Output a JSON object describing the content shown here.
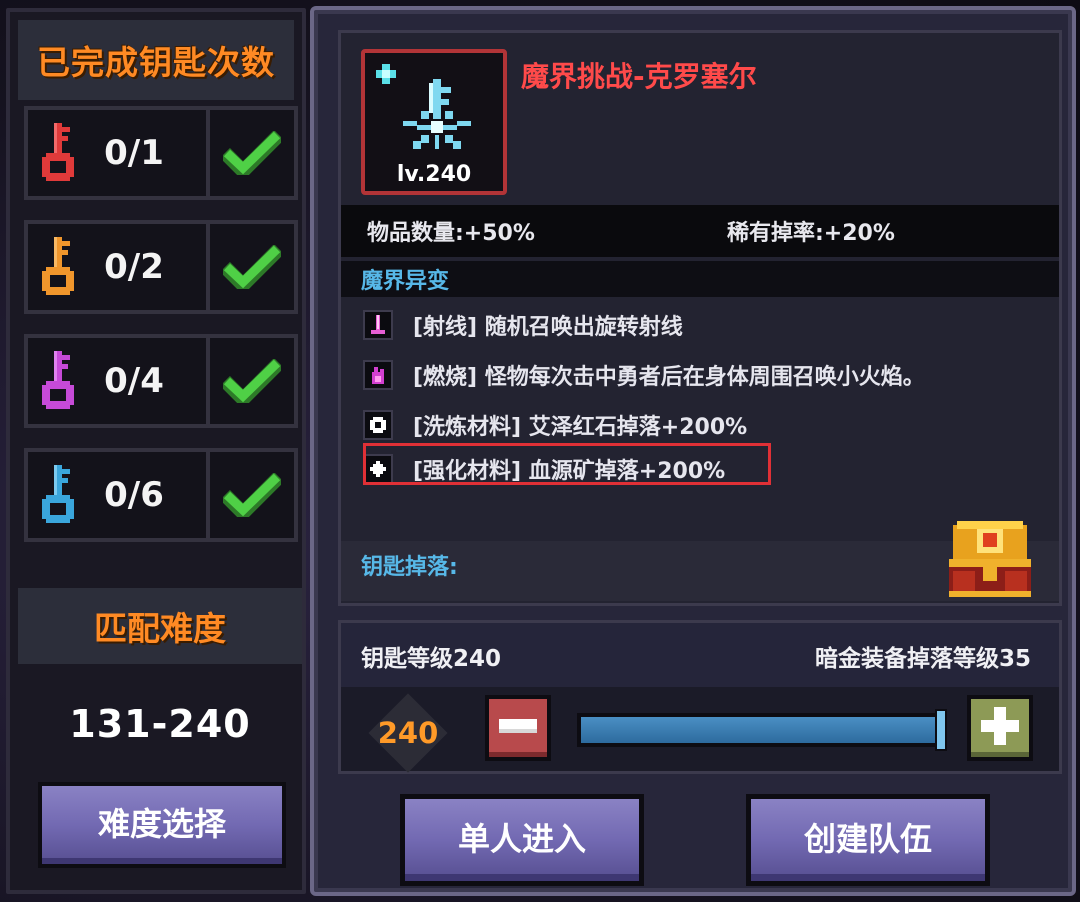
{
  "left_panel": {
    "title": "已完成钥匙次数",
    "key_rows": [
      {
        "count": "0/1",
        "color": "#e03a3a",
        "key_icon": "red-key-icon",
        "completed": true
      },
      {
        "count": "0/2",
        "color": "#f0962c",
        "key_icon": "orange-key-icon",
        "completed": true
      },
      {
        "count": "0/4",
        "color": "#c64ad8",
        "key_icon": "purple-key-icon",
        "completed": true
      },
      {
        "count": "0/6",
        "color": "#3aa6dc",
        "key_icon": "blue-key-icon",
        "completed": true
      }
    ],
    "match_title": "匹配难度",
    "match_range": "131-240",
    "difficulty_button": "难度选择"
  },
  "challenge": {
    "name": "魔界挑战-克罗塞尔",
    "item_level": "lv.240",
    "item_icon": "ice-crystal-key-icon",
    "stats": {
      "item_quantity": "物品数量:+50%",
      "rare_drop": "稀有掉率:+20%"
    },
    "mutation_label": "魔界异变",
    "modifiers": [
      {
        "text": "[射线] 随机召唤出旋转射线",
        "icon": "beam-icon"
      },
      {
        "text": "[燃烧] 怪物每次击中勇者后在身体周围召唤小火焰。",
        "icon": "flame-icon"
      },
      {
        "text": "[洗炼材料] 艾泽红石掉落+200%",
        "icon": "gear-gem-icon"
      },
      {
        "text": "[强化材料] 血源矿掉落+200%",
        "icon": "diamond-ore-icon",
        "highlighted": true
      }
    ],
    "key_drop_label": "钥匙掉落:",
    "chest_icon": "treasure-chest-icon"
  },
  "level_select": {
    "key_level": "钥匙等级240",
    "equip_drop_level": "暗金装备掉落等级35",
    "current_level": "240",
    "slider_fraction": 1.0
  },
  "actions": {
    "solo_enter": "单人进入",
    "create_team": "创建队伍"
  },
  "colors": {
    "accent_orange": "#ff8a24",
    "title_red": "#ff4a4a",
    "label_blue": "#57b8e8",
    "check_green": "#4fd046",
    "button_purple": "#7269b2"
  }
}
